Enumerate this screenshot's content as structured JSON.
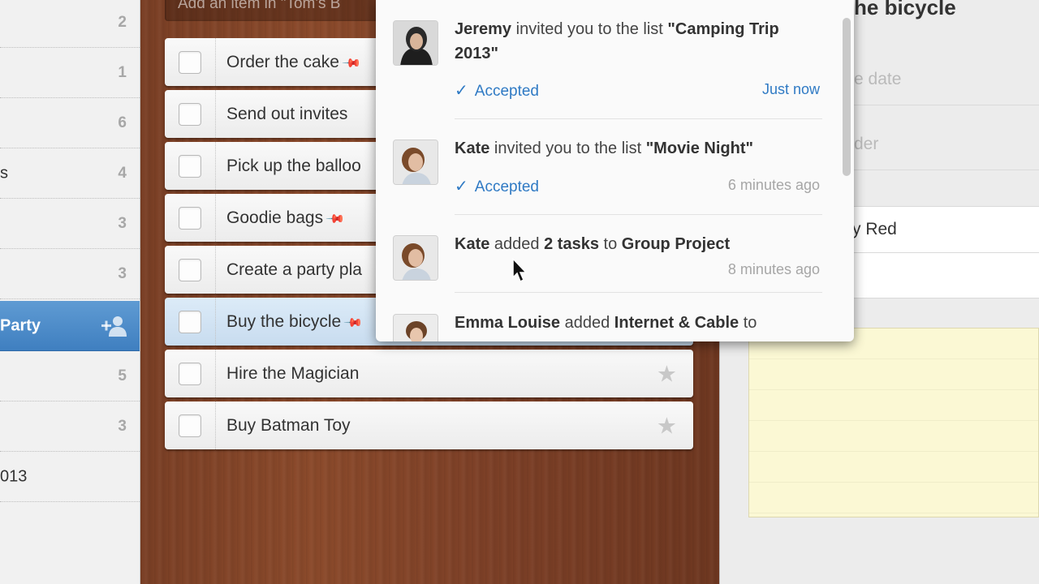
{
  "sidebar": {
    "items": [
      {
        "label": "",
        "count": "2"
      },
      {
        "label": "",
        "count": "1"
      },
      {
        "label": "",
        "count": "6"
      },
      {
        "label": "s",
        "count": "4"
      },
      {
        "label": "",
        "count": "3"
      },
      {
        "label": "",
        "count": "3"
      },
      {
        "label": "Party",
        "count": ""
      },
      {
        "label": "",
        "count": "5"
      },
      {
        "label": "",
        "count": "3"
      },
      {
        "label": "013",
        "count": ""
      }
    ]
  },
  "add_item": {
    "placeholder": "Add an item in \"Tom's B"
  },
  "tasks": [
    {
      "title": "Order the cake",
      "pinned": true
    },
    {
      "title": "Send out invites",
      "pinned": false
    },
    {
      "title": "Pick up the balloo",
      "pinned": false
    },
    {
      "title": "Goodie bags",
      "pinned": true
    },
    {
      "title": "Create a party pla",
      "pinned": false
    },
    {
      "title": "Buy the bicycle",
      "pinned": true
    },
    {
      "title": "Hire the Magician",
      "pinned": false
    },
    {
      "title": "Buy Batman Toy",
      "pinned": false
    }
  ],
  "detail": {
    "title": "he bicycle",
    "due_date": "e date",
    "reminder": "der",
    "subtask": "y Red"
  },
  "notifications": [
    {
      "actor": "Jeremy",
      "text": "invited you to the list",
      "target": "\"Camping Trip 2013\"",
      "status": "Accepted",
      "time": "Just now"
    },
    {
      "actor": "Kate",
      "text": "invited you to the list",
      "target": "\"Movie Night\"",
      "status": "Accepted",
      "time": "6 minutes ago"
    },
    {
      "actor": "Kate",
      "text": "added",
      "count": "2 tasks",
      "text2": "to",
      "target": "Group Project",
      "time": "8 minutes ago"
    },
    {
      "actor": "Emma Louise",
      "text": "added",
      "target": "Internet & Cable",
      "text2": "to"
    }
  ],
  "colors": {
    "accent": "#2f7ac4",
    "sidebar_active": "#4a8ac8",
    "notes": "#fbf8d4"
  }
}
